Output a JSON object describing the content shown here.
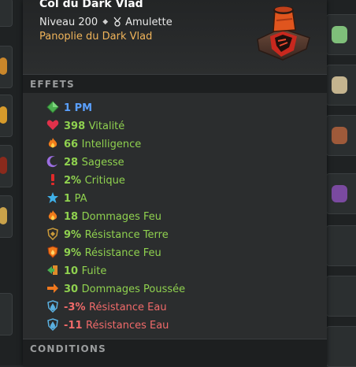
{
  "item": {
    "name": "Col du Dark Vlad",
    "level": "Niveau 200",
    "type": "Amulette",
    "set": "Panoplie du Dark Vlad"
  },
  "sections": {
    "effects_title": "EFFETS",
    "conditions_title": "CONDITIONS"
  },
  "effects": [
    {
      "value": "1 PM",
      "label": "",
      "icon": "pm-diamond-icon",
      "tone": "blue"
    },
    {
      "value": "398",
      "label": "Vitalité",
      "icon": "heart-icon",
      "tone": "pos"
    },
    {
      "value": "66",
      "label": "Intelligence",
      "icon": "fire-icon",
      "tone": "pos"
    },
    {
      "value": "28",
      "label": "Sagesse",
      "icon": "moon-icon",
      "tone": "pos"
    },
    {
      "value": "2%",
      "label": "Critique",
      "icon": "exclamation-icon",
      "tone": "pos"
    },
    {
      "value": "1",
      "label": "PA",
      "icon": "star-icon",
      "tone": "pos"
    },
    {
      "value": "18",
      "label": "Dommages Feu",
      "icon": "fire-icon",
      "tone": "pos"
    },
    {
      "value": "9%",
      "label": "Résistance Terre",
      "icon": "shield-earth-icon",
      "tone": "pos"
    },
    {
      "value": "9%",
      "label": "Résistance Feu",
      "icon": "shield-fire-icon",
      "tone": "pos"
    },
    {
      "value": "10",
      "label": "Fuite",
      "icon": "escape-icon",
      "tone": "pos"
    },
    {
      "value": "30",
      "label": "Dommages Poussée",
      "icon": "push-arrow-icon",
      "tone": "pos"
    },
    {
      "value": "-3%",
      "label": "Résistance Eau",
      "icon": "shield-water-icon",
      "tone": "neg"
    },
    {
      "value": "-11",
      "label": "Résistances Eau",
      "icon": "shield-water-icon",
      "tone": "neg"
    }
  ],
  "colors": {
    "positive": "#8fd14f",
    "negative": "#f06a6a",
    "pm": "#5aa0ff",
    "set": "#f0b45a"
  }
}
